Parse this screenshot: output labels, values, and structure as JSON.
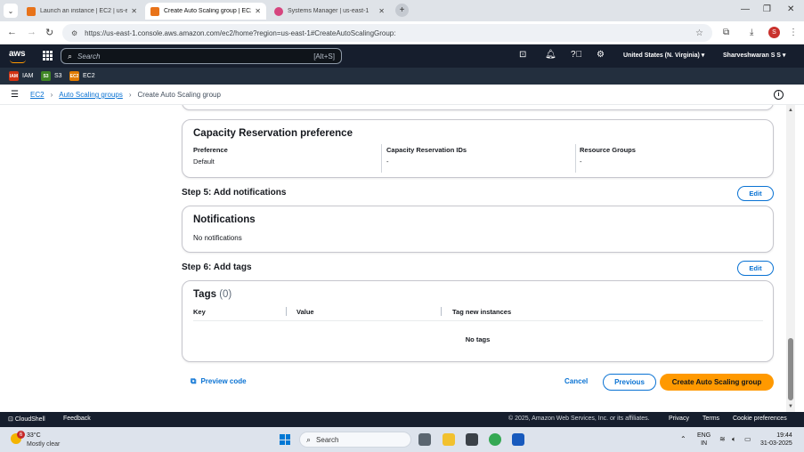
{
  "browser": {
    "tabs": [
      {
        "title": "Launch an instance | EC2 | us-e",
        "color": "#e8731a"
      },
      {
        "title": "Create Auto Scaling group | EC2",
        "color": "#e8731a"
      },
      {
        "title": "Systems Manager | us-east-1",
        "color": "#d6457e"
      }
    ],
    "url": "https://us-east-1.console.aws.amazon.com/ec2/home?region=us-east-1#CreateAutoScalingGroup:",
    "profile_initial": "S"
  },
  "aws_nav": {
    "logo": "aws",
    "search_placeholder": "Search",
    "search_shortcut": "[Alt+S]",
    "region": "United States (N. Virginia)",
    "user": "Sharveshwaran S S"
  },
  "favorites": [
    {
      "label": "IAM",
      "color": "#d13212",
      "icon": "IAM"
    },
    {
      "label": "S3",
      "color": "#3f8624",
      "icon": "S3"
    },
    {
      "label": "EC2",
      "color": "#e07b00",
      "icon": "EC2"
    }
  ],
  "breadcrumb": {
    "items": [
      "EC2",
      "Auto Scaling groups"
    ],
    "current": "Create Auto Scaling group"
  },
  "capacity_reservation": {
    "title": "Capacity Reservation preference",
    "fields": [
      {
        "label": "Preference",
        "value": "Default"
      },
      {
        "label": "Capacity Reservation IDs",
        "value": "-"
      },
      {
        "label": "Resource Groups",
        "value": "-"
      }
    ]
  },
  "step5": {
    "title": "Step 5: Add notifications",
    "edit_label": "Edit",
    "card_title": "Notifications",
    "text": "No notifications"
  },
  "step6": {
    "title": "Step 6: Add tags",
    "edit_label": "Edit",
    "card_title": "Tags",
    "count": "(0)",
    "columns": [
      "Key",
      "Value",
      "Tag new instances"
    ],
    "empty": "No tags"
  },
  "actions": {
    "preview": "Preview code",
    "cancel": "Cancel",
    "previous": "Previous",
    "create": "Create Auto Scaling group"
  },
  "aws_footer": {
    "cloudshell": "CloudShell",
    "feedback": "Feedback",
    "copyright": "© 2025, Amazon Web Services, Inc. or its affiliates.",
    "privacy": "Privacy",
    "terms": "Terms",
    "cookies": "Cookie preferences"
  },
  "taskbar": {
    "temperature": "33°C",
    "weather": "Mostly clear",
    "weather_badge": "6",
    "search": "Search",
    "lang1": "ENG",
    "lang2": "IN",
    "time": "19:44",
    "date": "31-03-2025"
  }
}
